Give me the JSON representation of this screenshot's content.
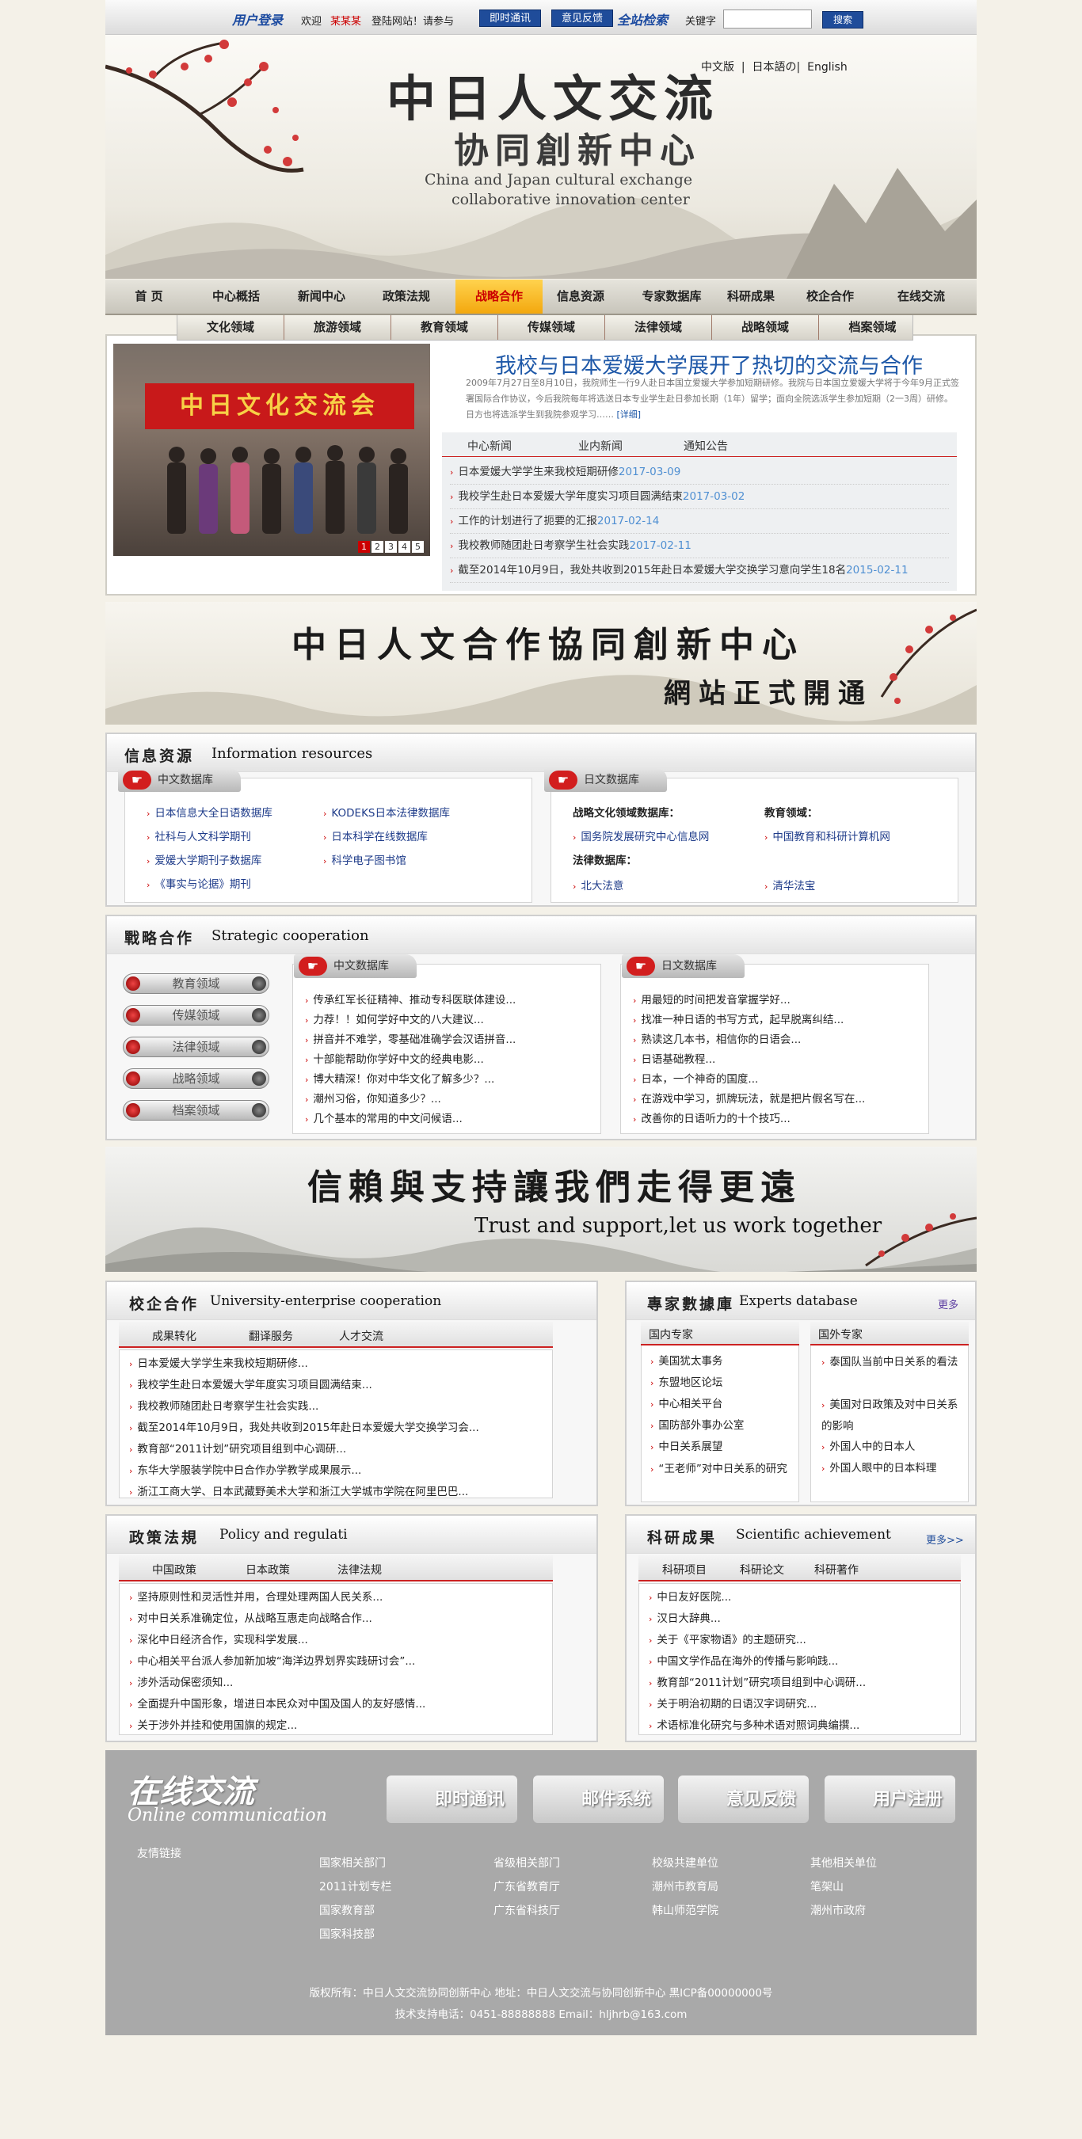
{
  "topbar": {
    "login_label": "用户登录",
    "welcome": "欢迎",
    "user": "某某某",
    "visit": "登陆网站！请参与",
    "im_btn": "即时通讯",
    "feedback_btn": "意见反馈",
    "site_search": "全站检索",
    "keyword": "关键字",
    "search_btn": "搜索",
    "search_value": ""
  },
  "banner": {
    "title": "中日人文交流",
    "subtitle": "协同創新中心",
    "en_line1": "China and Japan cultural exchange",
    "en_line2": "collaborative innovation center",
    "languages": [
      "中文版",
      "日本語の",
      "English"
    ]
  },
  "nav": [
    "首 页",
    "中心概括",
    "新闻中心",
    "政策法规",
    "战略合作",
    "信息资源",
    "专家数据库",
    "科研成果",
    "校企合作",
    "在线交流"
  ],
  "nav_active": "战略合作",
  "subnav": [
    "文化领域",
    "旅游领域",
    "教育领域",
    "传媒领域",
    "法律领域",
    "战略领域",
    "档案领域"
  ],
  "news": {
    "photo_banner": "中日文化交流会",
    "pager": [
      "1",
      "2",
      "3",
      "4",
      "5"
    ],
    "headline": "我校与日本爱媛大学展开了热切的交流与合作",
    "summary": "2009年7月27日至8月10日，我院师生一行9人赴日本国立爱媛大学参加短期研修。我院与日本国立爱媛大学将于今年9月正式签署国际合作协议，今后我院每年将选送日本专业学生赴日参加长期（1年）留学；面向全院选派学生参加短期（2一3周）研修。日方也将选派学生到我院参观学习……",
    "more": "[详细]",
    "tabs": [
      "中心新闻",
      "业内新闻",
      "通知公告"
    ],
    "items": [
      {
        "title": "日本爱媛大学学生来我校短期研修",
        "date": "2017-03-09"
      },
      {
        "title": "我校学生赴日本爱媛大学年度实习项目圆满结束",
        "date": "2017-03-02"
      },
      {
        "title": "工作的计划进行了扼要的汇报",
        "date": "2017-02-14"
      },
      {
        "title": "我校教师随团赴日考察学生社会实践",
        "date": "2017-02-11"
      },
      {
        "title": "截至2014年10月9日，我处共收到2015年赴日本爱媛大学交换学习意向学生18名",
        "date": "2015-02-11"
      }
    ]
  },
  "midbanner1": {
    "line1": "中日人文合作協同創新中心",
    "line2": "網站正式開通"
  },
  "info": {
    "cn": "信息资源",
    "en": "Information resources",
    "cn_db": "中文数据库",
    "jp_db": "日文数据库",
    "cn_links": [
      "日本信息大全日语数据库",
      "KODEKS日本法律数据库",
      "社科与人文科学期刊",
      "日本科学在线数据库",
      "爱媛大学期刊子数据库",
      "科学电子图书馆",
      "《事实与论据》期刊"
    ],
    "jp_heads": [
      "战略文化领域数据库：",
      "教育领域：",
      "法律数据库："
    ],
    "jp_links": [
      "国务院发展研究中心信息网",
      "中国教育和科研计算机网",
      "北大法意",
      "清华法宝"
    ]
  },
  "strategy": {
    "cn": "戰略合作",
    "en": "Strategic cooperation",
    "fields": [
      "教育领域",
      "传媒领域",
      "法律领域",
      "战略领域",
      "档案领域"
    ],
    "cn_db": "中文数据库",
    "jp_db": "日文数据库",
    "cn_list": [
      "传承红军长征精神、推动专科医联体建设...",
      "力荐！！如何学好中文的八大建议...",
      "拼音并不难学，零基础准确学会汉语拼音...",
      "十部能帮助你学好中文的经典电影...",
      "博大精深！你对中华文化了解多少？...",
      "潮州习俗，你知道多少？...",
      "几个基本的常用的中文问候语..."
    ],
    "jp_list": [
      "用最短的时间把发音掌握学好...",
      "找准一种日语的书写方式，起早脱离纠结...",
      "熟读这几本书，相信你的日语会...",
      "日语基础教程...",
      "日本，一个神奇的国度...",
      "在游戏中学习，抓牌玩法，就是把片假名写在...",
      "改善你的日语听力的十个技巧..."
    ]
  },
  "midbanner2": {
    "line1": "信賴與支持讓我們走得更遠",
    "line2": "Trust  and support,let us work together"
  },
  "uni": {
    "cn": "校企合作",
    "en": "University-enterprise cooperation",
    "tabs": [
      "成果转化",
      "翻译服务",
      "人才交流"
    ],
    "list": [
      "日本爱媛大学学生来我校短期研修...",
      "我校学生赴日本爱媛大学年度实习项目圆满结束...",
      "我校教师随团赴日考察学生社会实践...",
      "截至2014年10月9日，我处共收到2015年赴日本爱媛大学交换学习会...",
      "教育部“2011计划”研究项目组到中心调研...",
      "东华大学服装学院中日合作办学教学成果展示...",
      "浙江工商大学、日本武藏野美术大学和浙江大学城市学院在阿里巴巴..."
    ]
  },
  "experts": {
    "cn": "專家數據庫",
    "en": "Experts database",
    "more": "更多",
    "domestic": "国内专家",
    "foreign": "国外专家",
    "domestic_list": [
      "美国犹太事务",
      "东盟地区论坛",
      "中心相关平台",
      "国防部外事办公室",
      "中日关系展望",
      "“王老师”对中日关系的研究"
    ],
    "foreign_list": [
      "泰国队当前中日关系的看法",
      "美国对日政策及对中日关系的影响",
      "外国人中的日本人",
      "外国人眼中的日本料理"
    ]
  },
  "policy": {
    "cn": "政策法規",
    "en": "Policy and regulati",
    "tabs": [
      "中国政策",
      "日本政策",
      "法律法规"
    ],
    "list": [
      "坚持原则性和灵活性并用，合理处理两国人民关系...",
      "对中日关系准确定位，从战略互惠走向战略合作...",
      "深化中日经济合作，实现科学发展...",
      "中心相关平台派人参加新加坡“海洋边界划界实践研讨会”...",
      "涉外活动保密须知...",
      "全面提升中国形象，增进日本民众对中国及国人的友好感情...",
      "关于涉外并挂和使用国旗的规定..."
    ]
  },
  "research": {
    "cn": "科研成果",
    "en": "Scientific achievement",
    "more": "更多>>",
    "tabs": [
      "科研项目",
      "科研论文",
      "科研著作"
    ],
    "list": [
      "中日友好医院...",
      "汉日大辞典...",
      "关于《平家物语》的主题研究...",
      "中国文学作品在海外的传播与影响践...",
      "教育部“2011计划”研究项目组到中心调研...",
      "关于明治初期的日语汉字词研究...",
      "术语标准化研究与多种术语对照词典编撰..."
    ]
  },
  "footer": {
    "title": "在线交流",
    "title_en": "Online communication",
    "buttons": [
      "即时通讯",
      "邮件系统",
      "意见反馈",
      "用户注册"
    ],
    "friend_links": "友情链接",
    "links_col1": [
      "国家相关部门",
      "2011计划专栏",
      "国家教育部",
      "国家科技部"
    ],
    "links_col2": [
      "省级相关部门",
      "广东省教育厅",
      "广东省科技厅"
    ],
    "links_col3": [
      "校级共建单位",
      "潮州市教育局",
      "韩山师范学院"
    ],
    "links_col4": [
      "其他相关单位",
      "笔架山",
      "潮州市政府"
    ],
    "copyright": "版权所有：中日人文交流协同创新中心  地址：中日人文交流与协同创新中心  黑ICP备00000000号",
    "support": "技术支持电话：0451-88888888 Email：hljhrb@163.com"
  }
}
